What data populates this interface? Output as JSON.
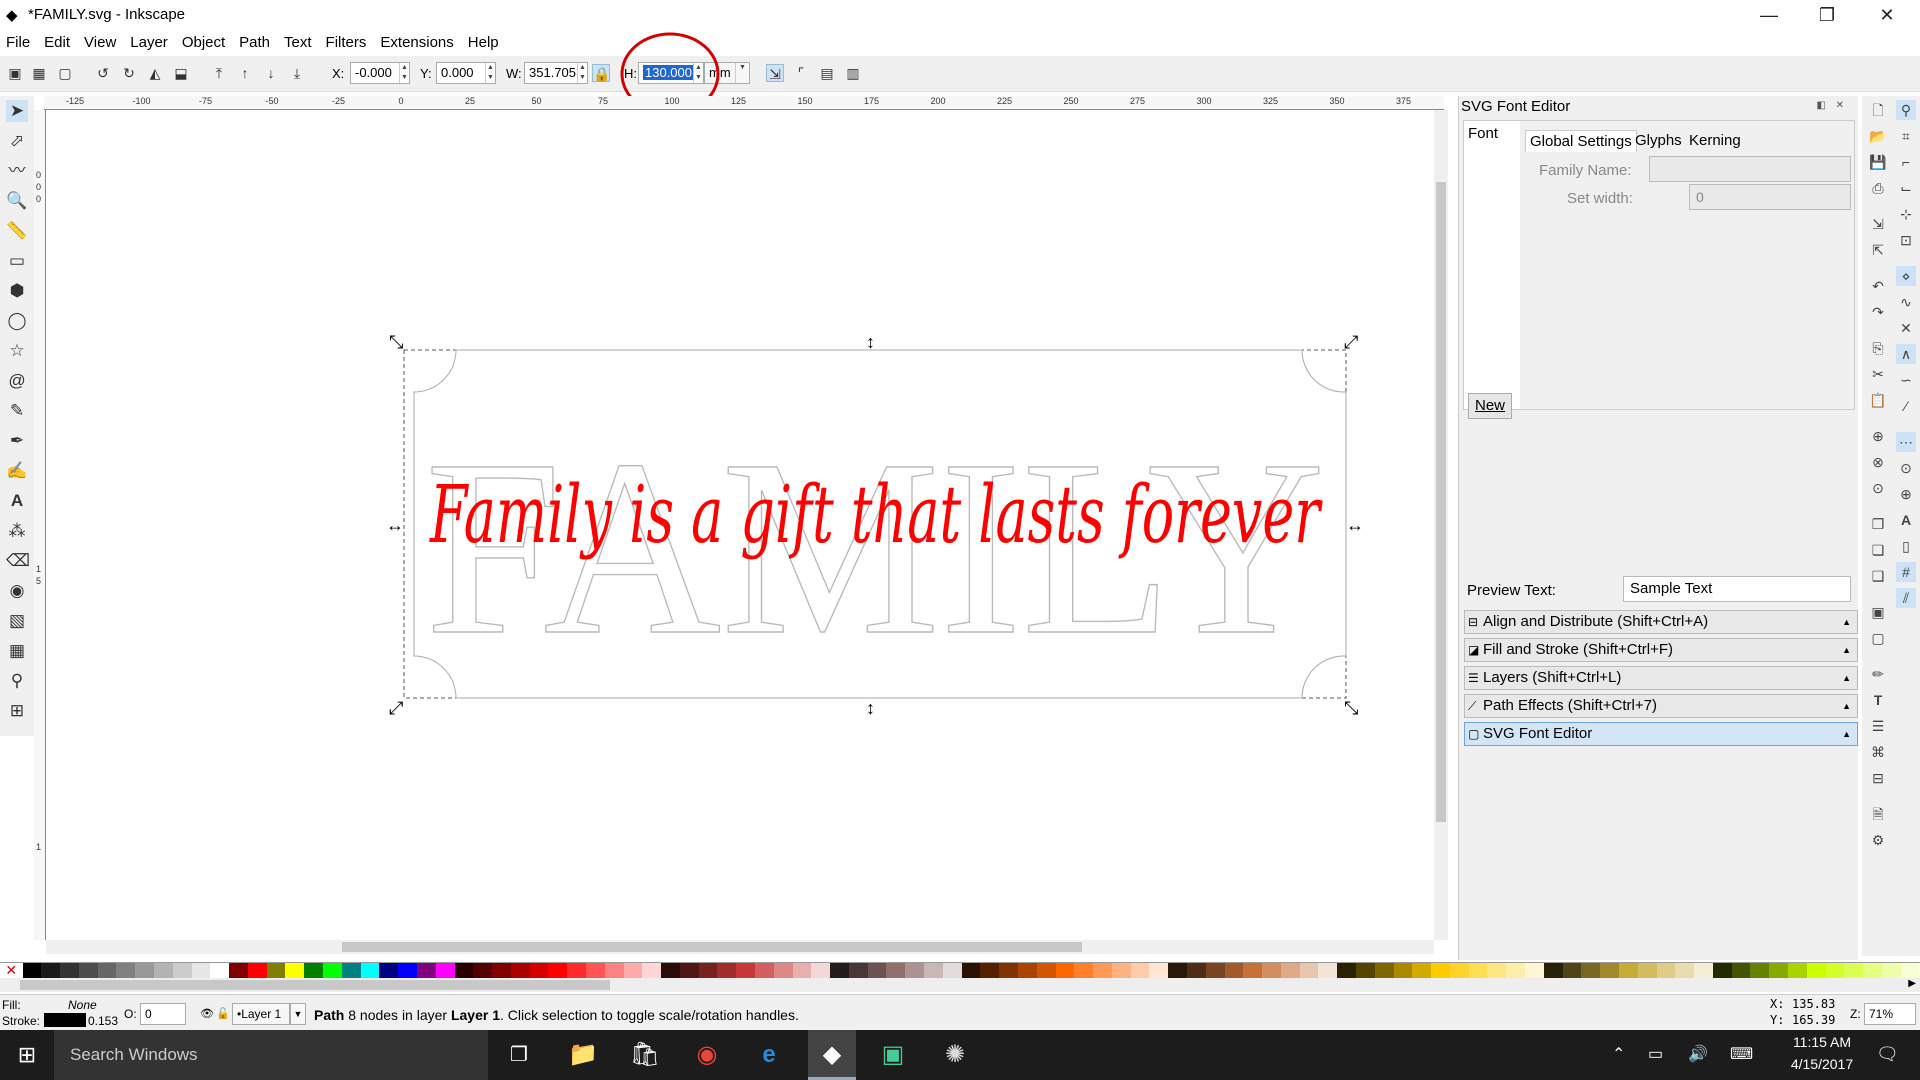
{
  "window": {
    "title": "*FAMILY.svg - Inkscape",
    "min": "—",
    "max": "❐",
    "close": "✕"
  },
  "menu": [
    "File",
    "Edit",
    "View",
    "Layer",
    "Object",
    "Path",
    "Text",
    "Filters",
    "Extensions",
    "Help"
  ],
  "toolbar": {
    "x_label": "X:",
    "x_value": "-0.000",
    "y_label": "Y:",
    "y_value": "0.000",
    "w_label": "W:",
    "w_value": "351.705",
    "h_label": "H:",
    "h_value": "130.000",
    "unit": "mm"
  },
  "ruler": {
    "h_ticks": [
      "-125",
      "-100",
      "-75",
      "-50",
      "-25",
      "0",
      "25",
      "50",
      "75",
      "100",
      "125",
      "150",
      "175",
      "200",
      "225",
      "250",
      "275",
      "300",
      "325",
      "350",
      "375"
    ],
    "v_ticks": [
      "0",
      "0",
      "0",
      "1",
      "5",
      "1"
    ]
  },
  "canvas": {
    "bg_word": "FAMILY",
    "script_text": "Family is a gift that lasts forever",
    "script_color": "#ff0000"
  },
  "dock": {
    "header": "SVG Font Editor",
    "font_tab": "Font",
    "tabs": [
      "Global Settings",
      "Glyphs",
      "Kerning"
    ],
    "family_label": "Family Name:",
    "family_value": "",
    "setwidth_label": "Set width:",
    "setwidth_value": "0",
    "new_button": "New",
    "preview_label": "Preview Text:",
    "preview_value": "Sample Text",
    "panels": [
      "Align and Distribute (Shift+Ctrl+A)",
      "Fill and Stroke (Shift+Ctrl+F)",
      "Layers (Shift+Ctrl+L)",
      "Path Effects  (Shift+Ctrl+7)",
      "SVG Font Editor"
    ]
  },
  "palette": [
    "#000000",
    "#1a1a1a",
    "#333333",
    "#4d4d4d",
    "#666666",
    "#808080",
    "#999999",
    "#b3b3b3",
    "#cccccc",
    "#e6e6e6",
    "#ffffff",
    "#800000",
    "#ff0000",
    "#808000",
    "#ffff00",
    "#008000",
    "#00ff00",
    "#008080",
    "#00ffff",
    "#000080",
    "#0000ff",
    "#800080",
    "#ff00ff",
    "#2b0000",
    "#550000",
    "#800000",
    "#aa0000",
    "#d40000",
    "#ff0000",
    "#ff2a2a",
    "#ff5555",
    "#ff8080",
    "#ffaaaa",
    "#ffd5d5",
    "#280b0b",
    "#501616",
    "#782121",
    "#a02c2c",
    "#c83737",
    "#d35f5f",
    "#de8787",
    "#e9afaf",
    "#f4d7d7",
    "#241c1c",
    "#483737",
    "#6c5353",
    "#916f6f",
    "#ac9393",
    "#c8b7b7",
    "#e3dbdb",
    "#2b1100",
    "#552200",
    "#803300",
    "#aa4400",
    "#d45500",
    "#ff6600",
    "#ff7f2a",
    "#ff9955",
    "#ffb380",
    "#ffccaa",
    "#ffe6d5",
    "#28170b",
    "#502d16",
    "#784421",
    "#a05a2c",
    "#c87137",
    "#d38d5f",
    "#deaa87",
    "#e9c6af",
    "#f4e3d7",
    "#2b2200",
    "#554400",
    "#806600",
    "#aa8800",
    "#d4aa00",
    "#ffcc00",
    "#ffd42a",
    "#ffdd55",
    "#ffe680",
    "#ffeeaa",
    "#fff6d5",
    "#28220b",
    "#504416",
    "#786721",
    "#a0892c",
    "#c8ab37",
    "#d3bc5f",
    "#decd87",
    "#e9ddaf",
    "#f4eed7",
    "#222b00",
    "#445500",
    "#668000",
    "#88aa00",
    "#aad400",
    "#ccff00",
    "#d4ff2a",
    "#ddff55",
    "#e5ff80",
    "#eeffaa",
    "#f6ffd5"
  ],
  "status": {
    "fill_label": "Fill:",
    "fill_value": "None",
    "stroke_label": "Stroke:",
    "stroke_width": "0.153",
    "opacity_label": "O:",
    "opacity_value": "0",
    "layer": "•Layer 1",
    "message_bold": "Path",
    "message": " 8 nodes in layer ",
    "message_layer": "Layer 1",
    "message_tail": ". Click selection to toggle scale/rotation handles.",
    "cx_label": "X:",
    "cx": "135.83",
    "cy_label": "Y:",
    "cy": "165.39",
    "zoom_label": "Z:",
    "zoom": "71%"
  },
  "taskbar": {
    "search": "Search Windows",
    "time": "11:15 AM",
    "date": "4/15/2017"
  }
}
